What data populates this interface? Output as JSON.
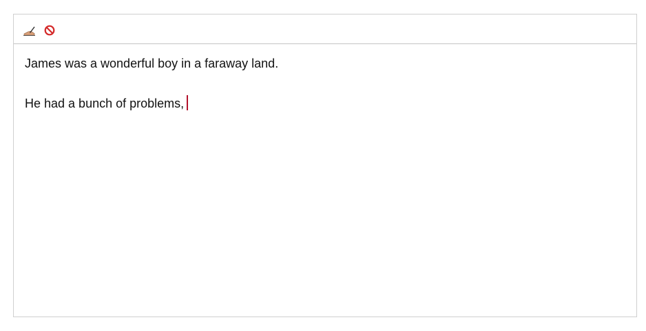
{
  "toolbar": {
    "buttons": [
      {
        "icon": "writing-hand-icon"
      },
      {
        "icon": "no-entry-icon"
      }
    ]
  },
  "editor": {
    "paragraphs": [
      "James was a wonderful boy in a faraway land.",
      "He had a bunch of problems,"
    ],
    "caret_color": "#b3122c"
  }
}
